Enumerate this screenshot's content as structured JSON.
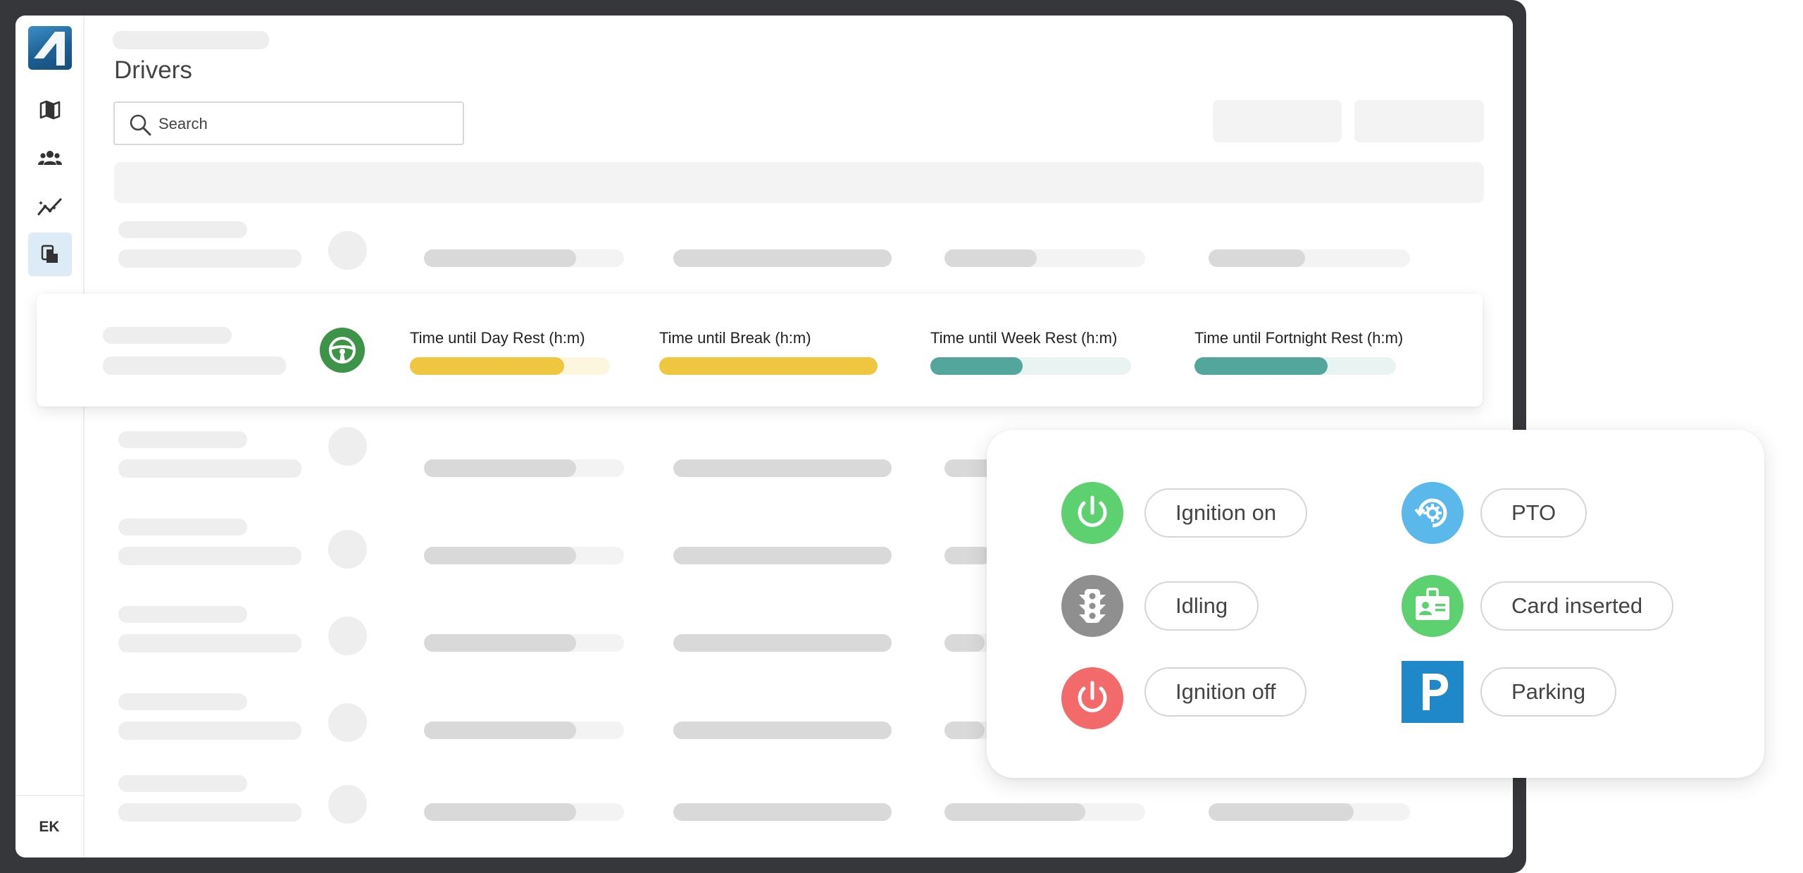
{
  "page": {
    "title": "Drivers"
  },
  "search": {
    "placeholder": "Search"
  },
  "sidebar": {
    "items": [
      {
        "icon": "map-icon"
      },
      {
        "icon": "users-icon"
      },
      {
        "icon": "analytics-icon"
      },
      {
        "icon": "documents-icon",
        "active": true
      }
    ],
    "user_initials": "EK"
  },
  "highlight_row": {
    "status_icon": "steering-wheel-icon",
    "metrics": [
      {
        "label": "Time until Day Rest (h:m)",
        "fill": 0.77,
        "color": "#eec63f",
        "track": "#fcf6df"
      },
      {
        "label": "Time until Break (h:m)",
        "fill": 1.0,
        "color": "#eec63f",
        "track": "#fcf6df"
      },
      {
        "label": "Time until Week Rest (h:m)",
        "fill": 0.46,
        "color": "#52a69c",
        "track": "#e9f4f2"
      },
      {
        "label": "Time until Fortnight Rest (h:m)",
        "fill": 0.66,
        "color": "#52a69c",
        "track": "#e9f4f2"
      }
    ]
  },
  "legend": {
    "items": [
      {
        "label": "Ignition on",
        "icon": "power-icon",
        "color": "#5dd06f"
      },
      {
        "label": "PTO",
        "icon": "pto-gear-icon",
        "color": "#5ab8ea"
      },
      {
        "label": "Idling",
        "icon": "traffic-light-icon",
        "color": "#8f8f8f"
      },
      {
        "label": "Card inserted",
        "icon": "id-card-icon",
        "color": "#5dd06f"
      },
      {
        "label": "Ignition off",
        "icon": "power-icon",
        "color": "#f26a6a"
      },
      {
        "label": "Parking",
        "icon": "parking-icon",
        "color": "#1e88c9"
      }
    ]
  }
}
